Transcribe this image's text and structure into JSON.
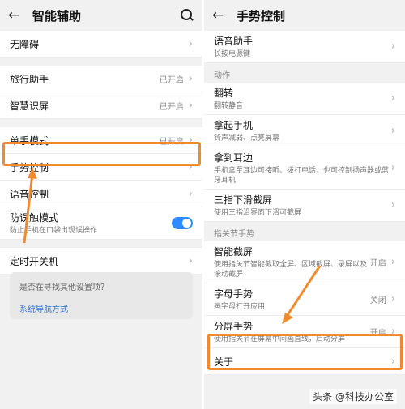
{
  "left": {
    "header": {
      "title": "智能辅助"
    },
    "items": [
      {
        "label": "无障碍",
        "status": ""
      },
      {
        "label": "旅行助手",
        "status": "已开启"
      },
      {
        "label": "智慧识屏",
        "status": "已开启"
      },
      {
        "label": "单手模式",
        "status": "已开启"
      },
      {
        "label": "手势控制",
        "status": ""
      },
      {
        "label": "语音控制",
        "status": ""
      },
      {
        "label": "防误触模式",
        "sub": "防止手机在口袋出现误操作"
      },
      {
        "label": "定时开关机",
        "status": ""
      }
    ],
    "suggest": {
      "question": "是否在寻找其他设置项？",
      "link": "系统导航方式"
    }
  },
  "right": {
    "header": {
      "title": "手势控制"
    },
    "voice": {
      "label": "语音助手",
      "sub": "长按电源键"
    },
    "section1": "动作",
    "actions": [
      {
        "label": "翻转",
        "sub": "翻转静音"
      },
      {
        "label": "拿起手机",
        "sub": "铃声减弱、点亮屏幕"
      },
      {
        "label": "拿到耳边",
        "sub": "手机拿至耳边可接听、拨打电话，也可控制扬声器或蓝牙耳机"
      },
      {
        "label": "三指下滑截屏",
        "sub": "使用三指沿界面下滑可截屏"
      }
    ],
    "section2": "指关节手势",
    "knuckle": [
      {
        "label": "智能截屏",
        "sub": "使用指关节智能截取全屏、区域截屏、录屏以及滚动截屏",
        "status": "开启"
      },
      {
        "label": "字母手势",
        "sub": "画字母打开应用",
        "status": "关闭"
      },
      {
        "label": "分屏手势",
        "sub": "使用指关节在屏幕中间画直线，启动分屏",
        "status": "开启"
      }
    ],
    "about": {
      "label": "关于"
    }
  },
  "watermark": "头条 @科技办公室"
}
